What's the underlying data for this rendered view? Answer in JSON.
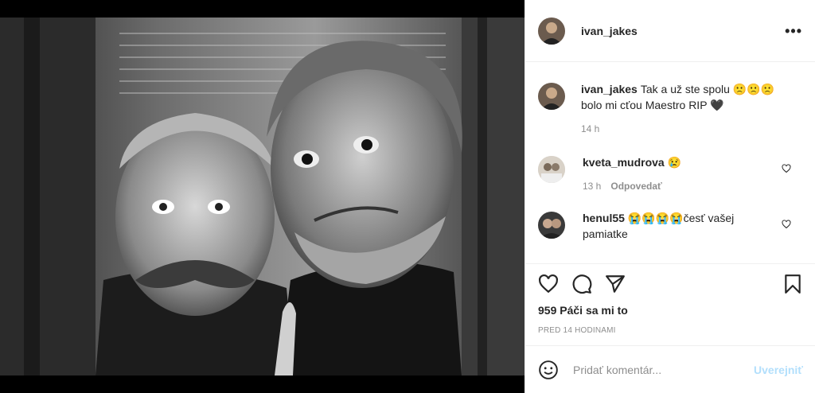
{
  "post": {
    "author": "ivan_jakes",
    "more_icon": "more-horizontal-icon",
    "caption": {
      "user": "ivan_jakes",
      "text": "Tak a už ste spolu 🙁🙁🙁 bolo mi cťou Maestro RIP 🖤",
      "time": "14 h"
    },
    "comments": [
      {
        "user": "kveta_mudrova",
        "text": "😢",
        "time": "13 h",
        "reply": "Odpovedať"
      },
      {
        "user": "henul55",
        "text": "😭😭😭😭česť vašej pamiatke",
        "time": "",
        "reply": ""
      }
    ],
    "likes": "959 Páči sa mi to",
    "posted": "PRED 14 HODINAMI",
    "add_comment": {
      "placeholder": "Pridať komentár...",
      "post_label": "Uverejniť"
    }
  },
  "colors": {
    "text": "#262626",
    "muted": "#8e8e8e",
    "disabled_post": "#b2dffc",
    "border": "#efefef"
  },
  "icons": [
    "heart-icon",
    "comment-icon",
    "share-icon",
    "bookmark-icon",
    "emoji-icon"
  ]
}
